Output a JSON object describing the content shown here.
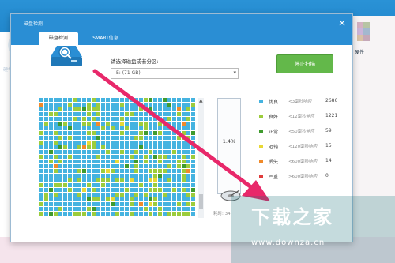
{
  "background": {
    "left_label": "硬件检测",
    "right_label": "硬件"
  },
  "dialog": {
    "title": "磁盘检测",
    "tabs": [
      {
        "label": "磁盘检测",
        "active": true
      },
      {
        "label": "SMART信息",
        "active": false
      }
    ],
    "select_label": "请选择磁盘或者分区:",
    "select_value": "E: (71 GB)",
    "stop_button": "停止扫描",
    "progress": "1.4%",
    "elapsed": "耗时: 34",
    "legend": [
      {
        "name": "优良",
        "desc": "<3毫秒响应",
        "count": "2686",
        "color": "#45b3e0"
      },
      {
        "name": "良好",
        "desc": "<12毫秒响应",
        "count": "1221",
        "color": "#9ccc3c"
      },
      {
        "name": "正常",
        "desc": "<50毫秒响应",
        "count": "59",
        "color": "#3f9b2e"
      },
      {
        "name": "迟钝",
        "desc": "<120毫秒响应",
        "count": "15",
        "color": "#e8d835"
      },
      {
        "name": "丢失",
        "desc": "<600毫秒响应",
        "count": "14",
        "color": "#f08a2a"
      },
      {
        "name": "严重",
        "desc": ">600毫秒响应",
        "count": "0",
        "color": "#e03b3b"
      }
    ]
  },
  "watermark": {
    "title": "下载之家",
    "url": "www.downza.cn"
  }
}
